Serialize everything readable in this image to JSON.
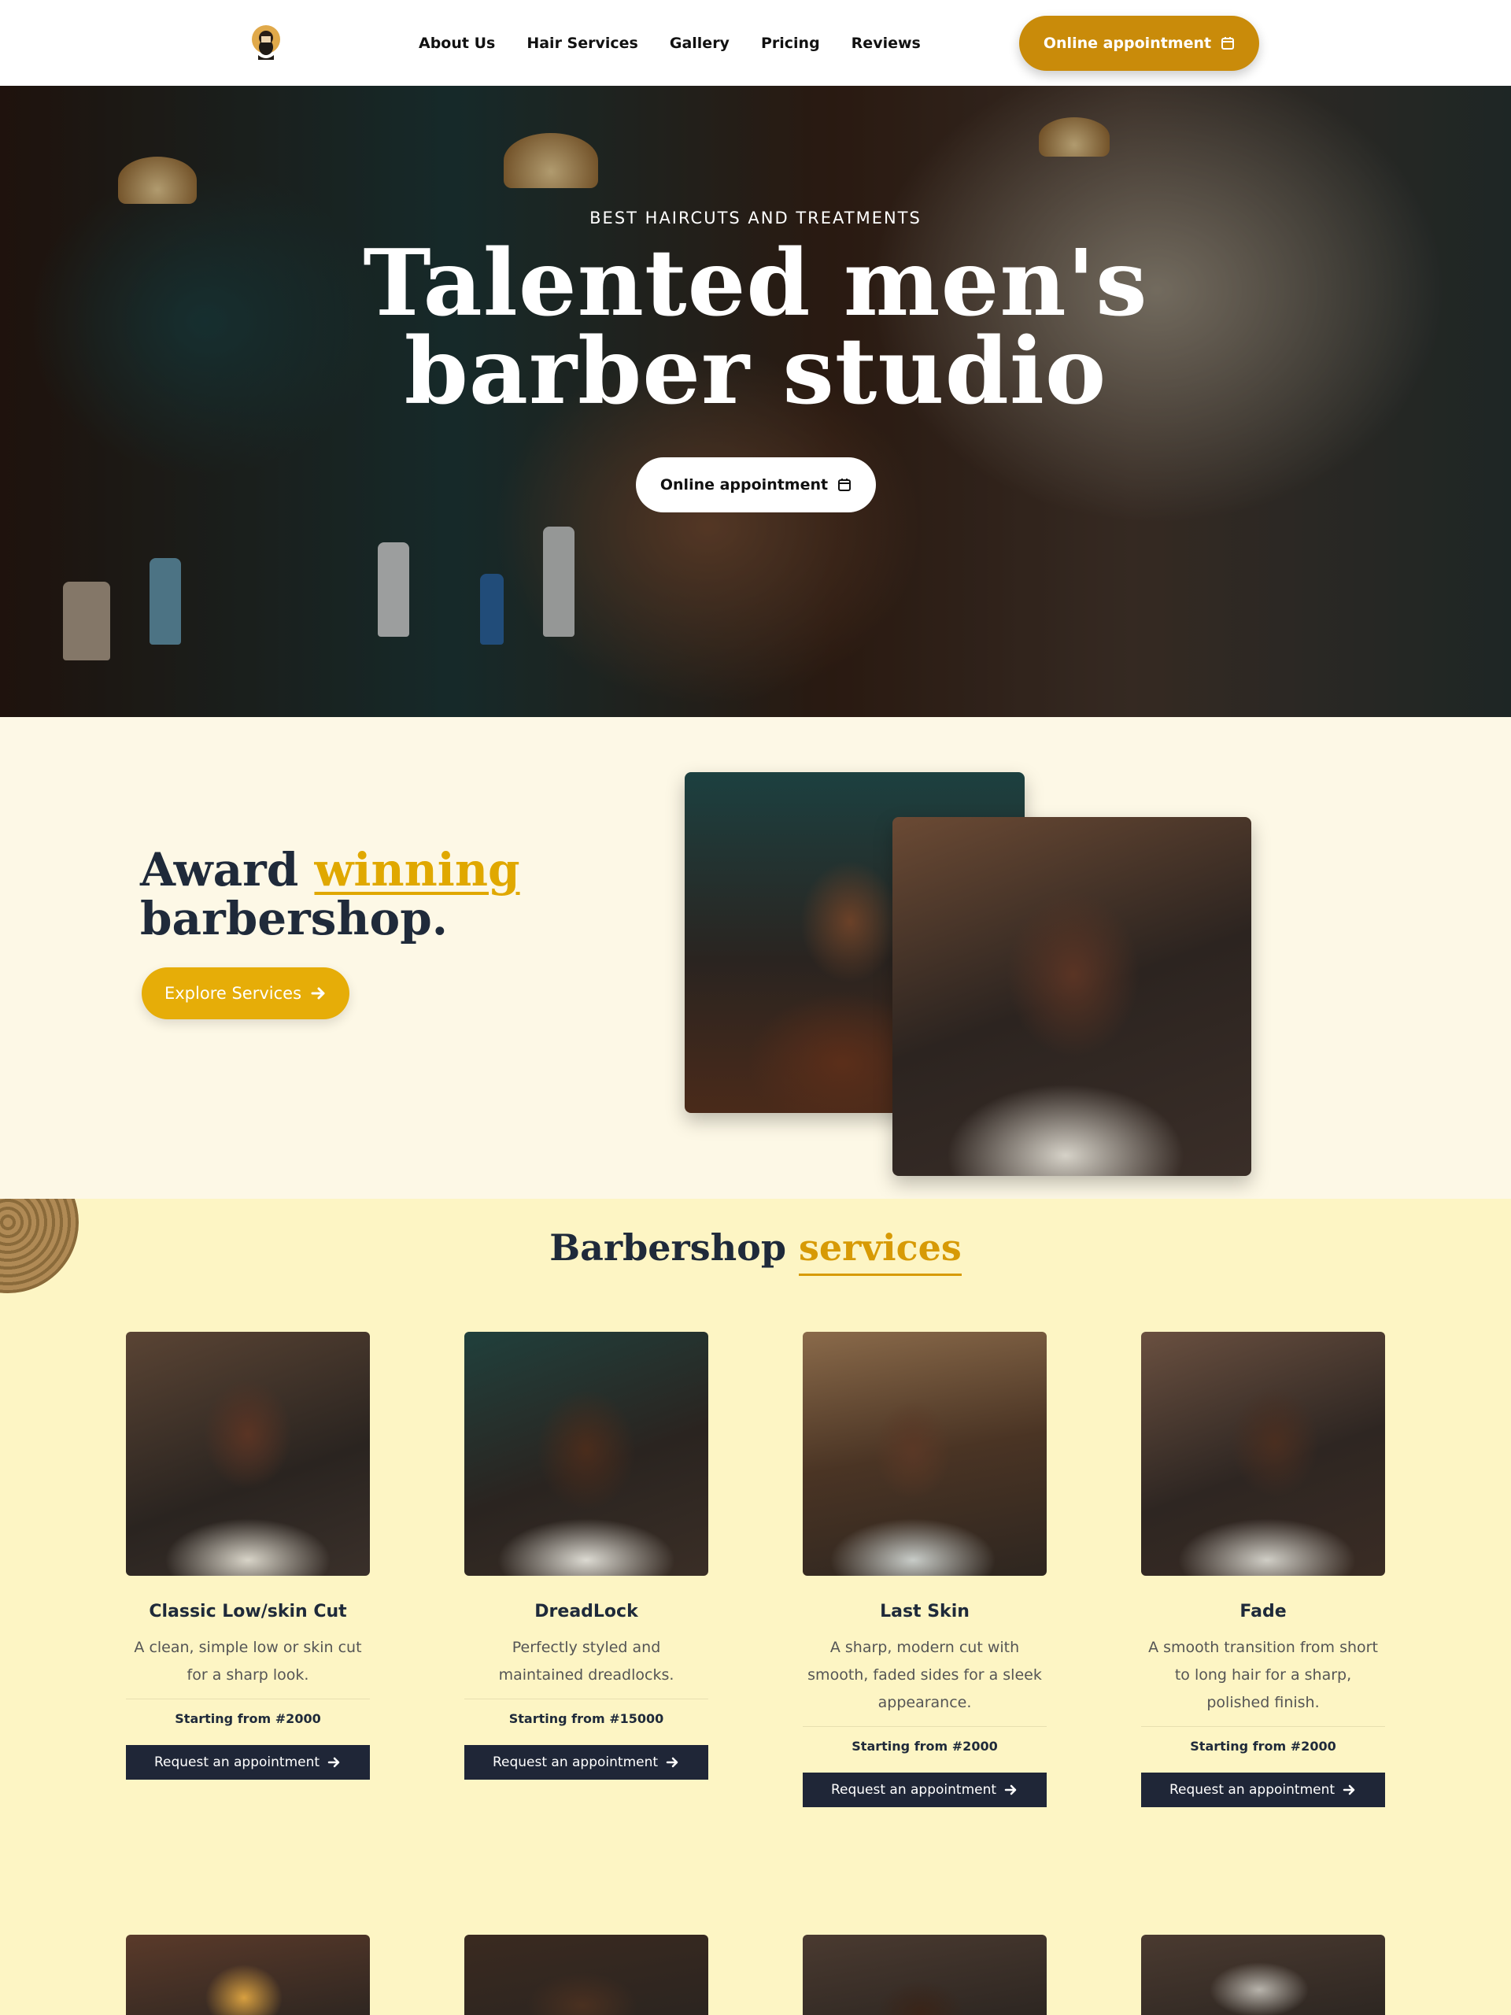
{
  "nav": {
    "links": [
      "About Us",
      "Hair Services",
      "Gallery",
      "Pricing",
      "Reviews"
    ],
    "cta_label": "Online appointment"
  },
  "hero": {
    "eyebrow": "BEST HAIRCUTS AND TREATMENTS",
    "title_line1": "Talented men's",
    "title_line2": "barber studio",
    "cta_label": "Online appointment"
  },
  "award": {
    "title_part1": "Award",
    "title_highlight": "winning",
    "title_part2": "barbershop.",
    "button_label": "Explore Services"
  },
  "services": {
    "title_part1": "Barbershop",
    "title_highlight": "services",
    "items": [
      {
        "name": "Classic Low/skin Cut",
        "description": "A clean, simple low or skin cut for a sharp look.",
        "price": "Starting from #2000",
        "button": "Request an appointment"
      },
      {
        "name": "DreadLock",
        "description": "Perfectly styled and maintained dreadlocks.",
        "price": "Starting from #15000",
        "button": "Request an appointment"
      },
      {
        "name": "Last Skin",
        "description": "A sharp, modern cut with smooth, faded sides for a sleek appearance.",
        "price": "Starting from #2000",
        "button": "Request an appointment"
      },
      {
        "name": "Fade",
        "description": "A smooth transition from short to long hair for a sharp, polished finish.",
        "price": "Starting from #2000",
        "button": "Request an appointment"
      }
    ]
  },
  "colors": {
    "accent": "#c98b0a",
    "highlight": "#e0a800",
    "dark": "#1f2637",
    "services_bg": "#fdf5c4",
    "award_bg": "#fdf8e6"
  },
  "icons": {
    "logo": "bearded-barber-logo",
    "appointment": "calendar-icon",
    "arrow": "arrow-right-icon"
  }
}
